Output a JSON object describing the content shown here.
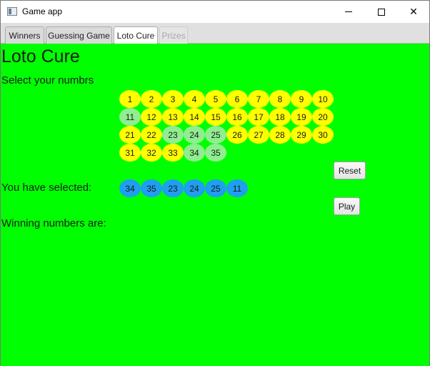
{
  "window": {
    "title": "Game app",
    "close_glyph": "✕"
  },
  "tabs": [
    {
      "label": "Winners",
      "state": "normal"
    },
    {
      "label": "Guessing Game",
      "state": "normal"
    },
    {
      "label": "Loto Cure",
      "state": "active"
    },
    {
      "label": "Prizes",
      "state": "disabled"
    }
  ],
  "main": {
    "heading": "Loto Cure",
    "select_label": "Select your numbrs",
    "selected_label": "You have selected:",
    "winning_label": "Winning numbers are:",
    "reset_label": "Reset",
    "play_label": "Play"
  },
  "grid": {
    "numbers": [
      "1",
      "2",
      "3",
      "4",
      "5",
      "6",
      "7",
      "8",
      "9",
      "10",
      "11",
      "12",
      "13",
      "14",
      "15",
      "16",
      "17",
      "18",
      "19",
      "20",
      "21",
      "22",
      "23",
      "24",
      "25",
      "26",
      "27",
      "28",
      "29",
      "30",
      "31",
      "32",
      "33",
      "34",
      "35"
    ],
    "picked": [
      "11",
      "23",
      "24",
      "25",
      "34",
      "35"
    ]
  },
  "selected_numbers": [
    "34",
    "35",
    "23",
    "24",
    "25",
    "11"
  ],
  "winning_numbers": [],
  "colors": {
    "background": "#00ff00",
    "ball": "#ffff00",
    "picked_ball": "#90ee90",
    "selected_ball": "#1e9ff0"
  }
}
